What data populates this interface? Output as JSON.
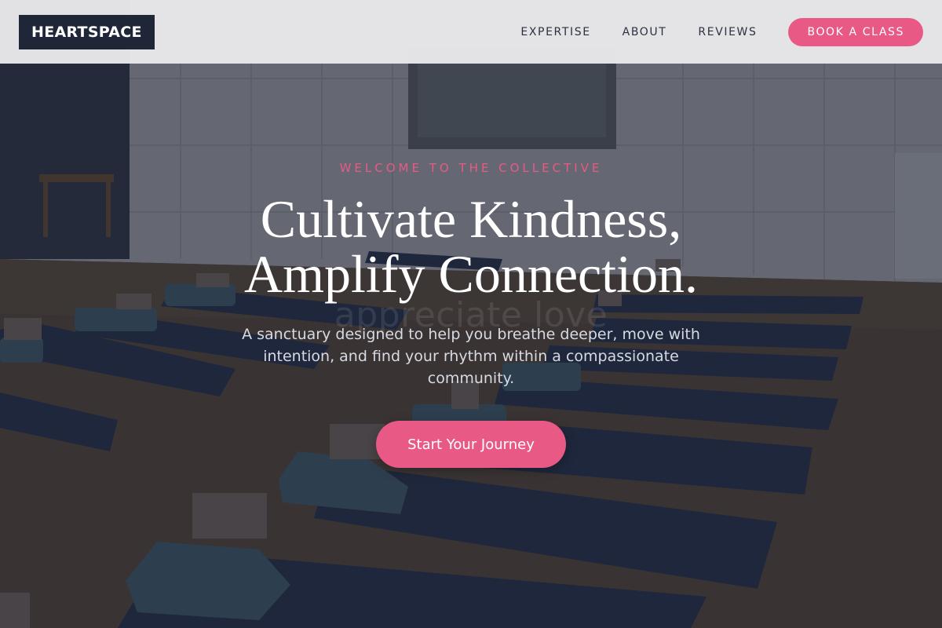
{
  "header": {
    "logo": "HEARTSPACE",
    "nav": {
      "expertise": "EXPERTISE",
      "about": "ABOUT",
      "reviews": "REVIEWS"
    },
    "cta_label": "BOOK A CLASS"
  },
  "hero": {
    "eyebrow": "WELCOME TO THE COLLECTIVE",
    "headline_line1": "Cultivate Kindness,",
    "headline_line2": "Amplify Connection.",
    "watermark": "appreciate love",
    "subtext": "A sanctuary designed to help you breathe deeper, move with intention, and find your rhythm within a compassionate community.",
    "button_label": "Start Your Journey"
  },
  "colors": {
    "accent": "#e85a85",
    "logo_bg": "#1e2638",
    "header_bg": "#e8e8ea",
    "nav_text": "#2c3142"
  }
}
